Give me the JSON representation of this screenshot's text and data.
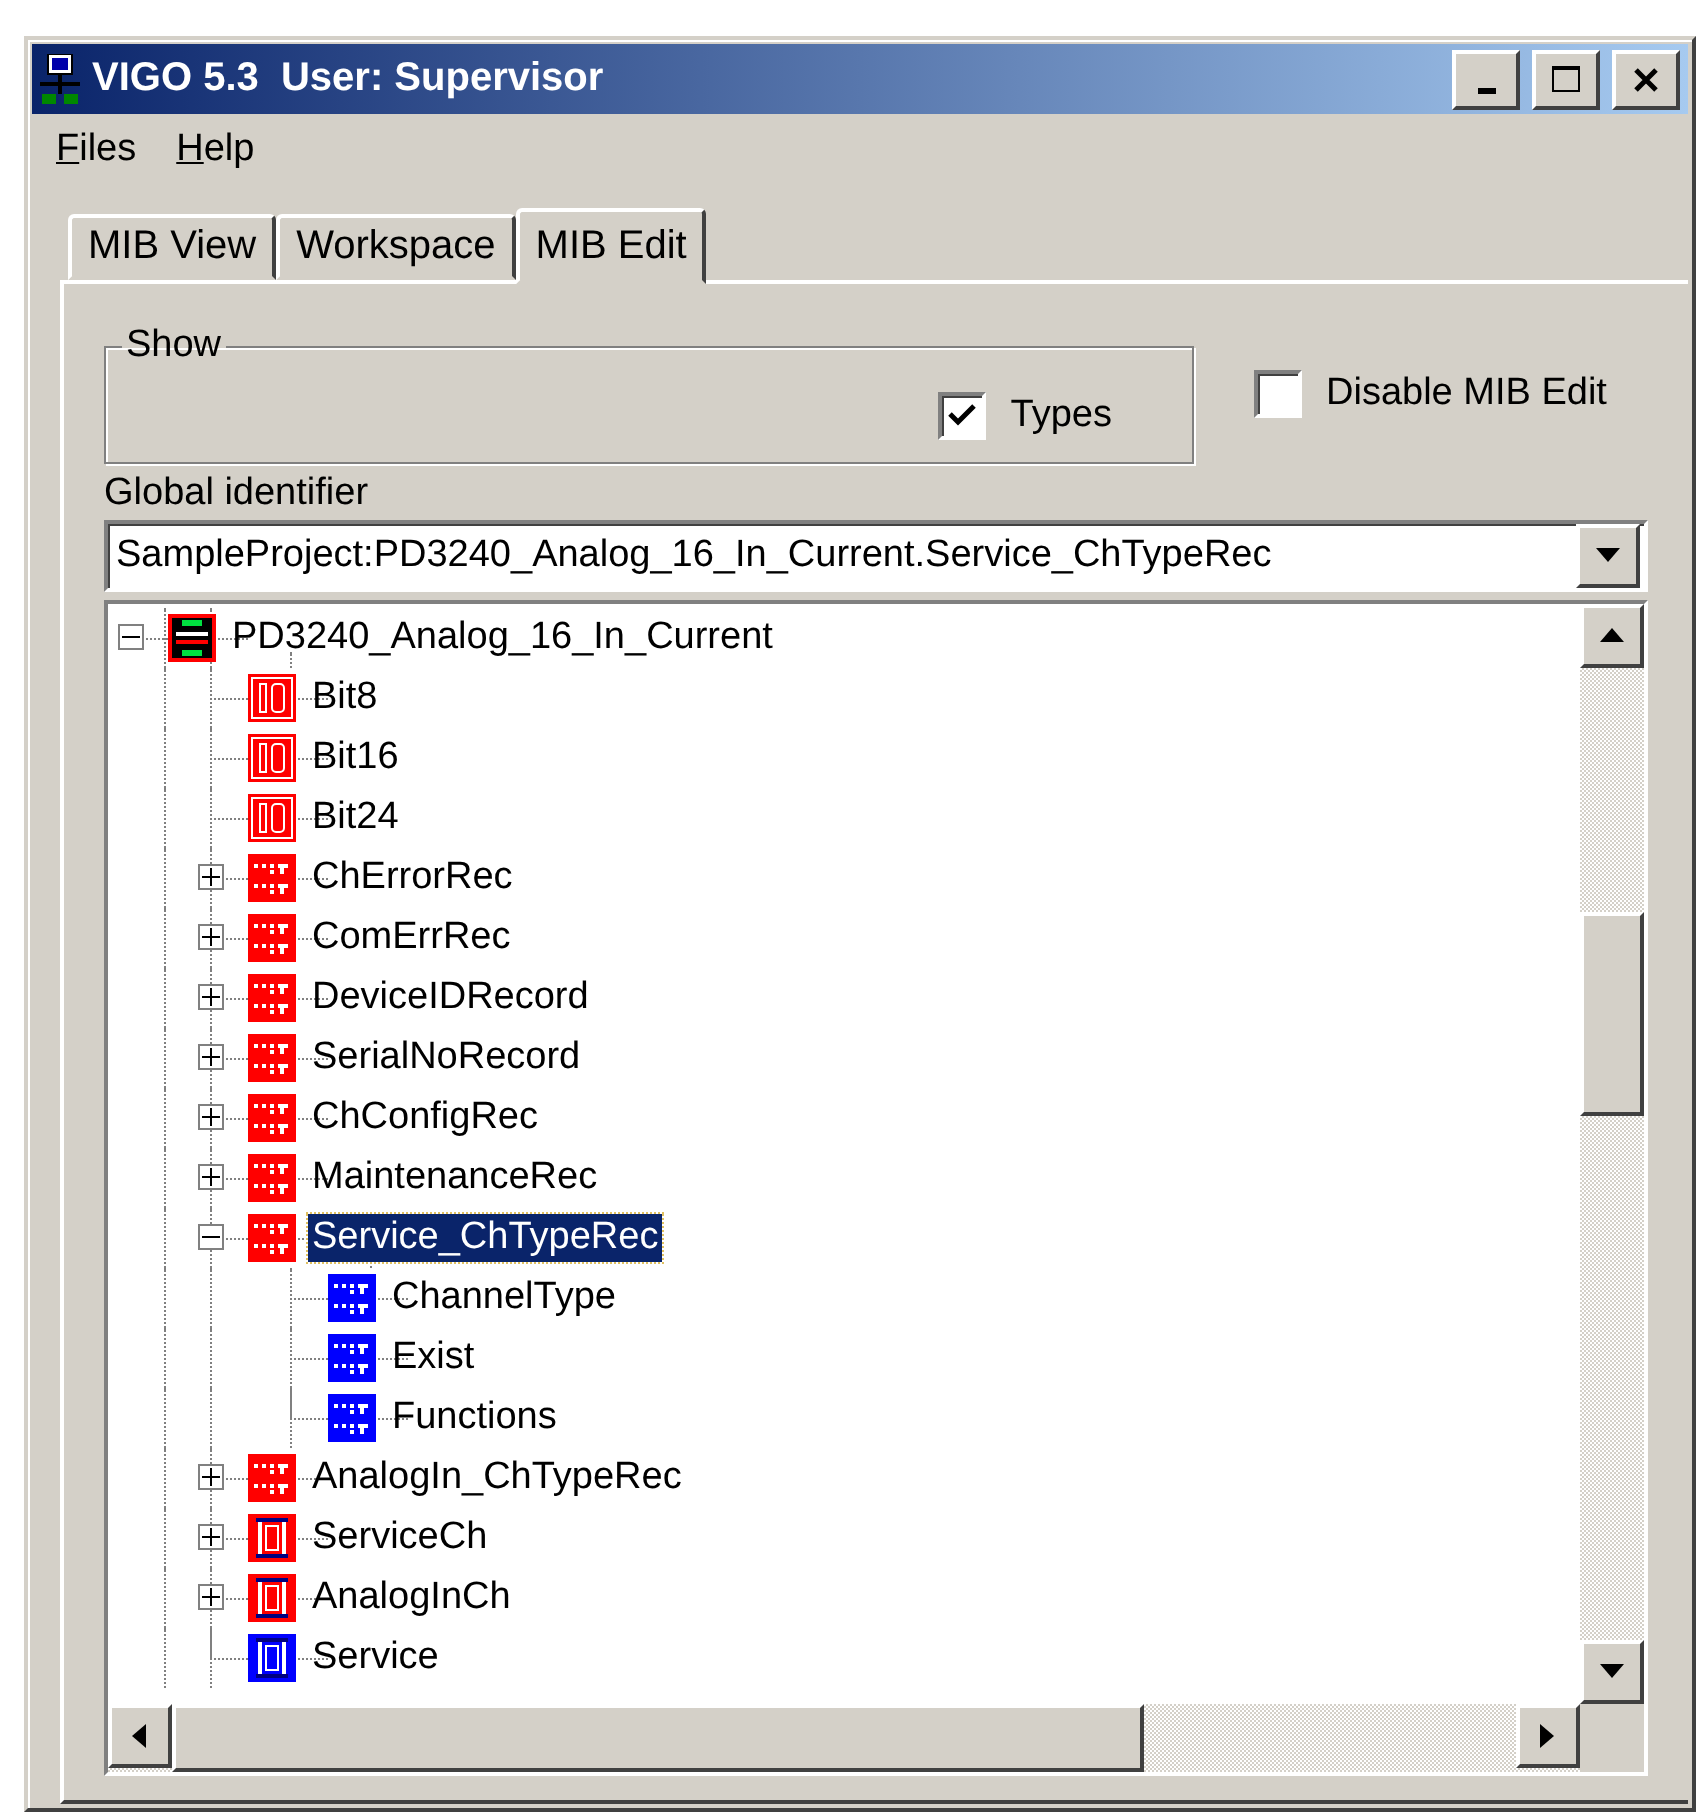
{
  "window": {
    "title": "VIGO 5.3  User: Supervisor"
  },
  "menu": [
    "Files",
    "Help"
  ],
  "tabs": [
    {
      "label": "MIB View",
      "selected": false
    },
    {
      "label": "Workspace",
      "selected": false
    },
    {
      "label": "MIB Edit",
      "selected": true
    }
  ],
  "show_group": {
    "title": "Show",
    "types": {
      "label": "Types",
      "checked": true
    }
  },
  "disable_mib_edit": {
    "label": "Disable MIB Edit",
    "checked": false
  },
  "global_identifier": {
    "label": "Global identifier",
    "value": "SampleProject:PD3240_Analog_16_In_Current.Service_ChTypeRec"
  },
  "tree": [
    {
      "label": "PD3240_Analog_16_In_Current",
      "kind": "device",
      "color": "#ff0000",
      "expanded": true,
      "selected": false,
      "children": [
        {
          "label": "Bit8",
          "kind": "bits",
          "color": "#ff0000",
          "selected": false
        },
        {
          "label": "Bit16",
          "kind": "bits",
          "color": "#ff0000",
          "selected": false
        },
        {
          "label": "Bit24",
          "kind": "bits",
          "color": "#ff0000",
          "selected": false
        },
        {
          "label": "ChErrorRec",
          "kind": "record",
          "color": "#ff0000",
          "expanded": false,
          "selected": false
        },
        {
          "label": "ComErrRec",
          "kind": "record",
          "color": "#ff0000",
          "expanded": false,
          "selected": false
        },
        {
          "label": "DeviceIDRecord",
          "kind": "record",
          "color": "#ff0000",
          "expanded": false,
          "selected": false
        },
        {
          "label": "SerialNoRecord",
          "kind": "record",
          "color": "#ff0000",
          "expanded": false,
          "selected": false
        },
        {
          "label": "ChConfigRec",
          "kind": "record",
          "color": "#ff0000",
          "expanded": false,
          "selected": false
        },
        {
          "label": "MaintenanceRec",
          "kind": "record",
          "color": "#ff0000",
          "expanded": false,
          "selected": false
        },
        {
          "label": "Service_ChTypeRec",
          "kind": "record",
          "color": "#ff0000",
          "expanded": true,
          "selected": true,
          "children": [
            {
              "label": "ChannelType",
              "kind": "record",
              "color": "#0000ff",
              "selected": false
            },
            {
              "label": "Exist",
              "kind": "record",
              "color": "#0000ff",
              "selected": false
            },
            {
              "label": "Functions",
              "kind": "record",
              "color": "#0000ff",
              "selected": false
            }
          ]
        },
        {
          "label": "AnalogIn_ChTypeRec",
          "kind": "record",
          "color": "#ff0000",
          "expanded": false,
          "selected": false
        },
        {
          "label": "ServiceCh",
          "kind": "struct",
          "color": "#ff0000",
          "expanded": false,
          "selected": false
        },
        {
          "label": "AnalogInCh",
          "kind": "struct",
          "color": "#ff0000",
          "expanded": false,
          "selected": false
        },
        {
          "label": "Service",
          "kind": "struct",
          "color": "#0000ff",
          "selected": false
        }
      ]
    }
  ]
}
